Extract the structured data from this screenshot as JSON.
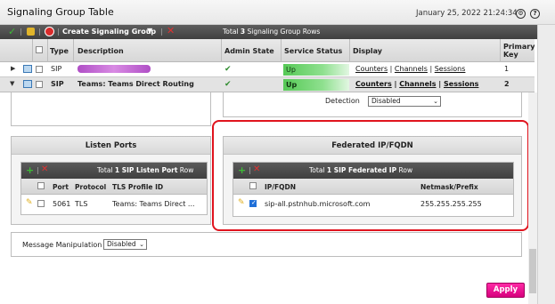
{
  "window": {
    "title": "Signaling Group Table",
    "date": "January 25, 2022 21:24:34",
    "icons": [
      "settings-icon",
      "help-icon"
    ]
  },
  "toolbar": {
    "create_label": "Create Signaling Group",
    "total_prefix": "Total ",
    "total_count": "3",
    "total_suffix": " Signaling Group Rows"
  },
  "table": {
    "columns": [
      "Type",
      "Description",
      "Admin State",
      "Service Status",
      "Display",
      "Primary Key"
    ],
    "rows": [
      {
        "type": "SIP",
        "description": "",
        "status": "Up",
        "links": [
          "Counters",
          "Channels",
          "Sessions"
        ],
        "key": "1"
      },
      {
        "type": "SIP",
        "description": "Teams: Teams Direct Routing",
        "status": "Up",
        "links": [
          "Counters",
          "Channels",
          "Sessions"
        ],
        "key": "2"
      }
    ]
  },
  "detection": {
    "label": "Detection",
    "value": "Disabled"
  },
  "listen_ports": {
    "title": "Listen Ports",
    "total_prefix": "Total ",
    "total_count": "1",
    "total_suffix": " SIP Listen Port",
    "total_unit": " Row",
    "columns": [
      "Port",
      "Protocol",
      "TLS Profile ID"
    ],
    "row": {
      "port": "5061",
      "protocol": "TLS",
      "tls": "Teams: Teams Direct ..."
    }
  },
  "federated": {
    "title": "Federated IP/FQDN",
    "total_prefix": "Total ",
    "total_count": "1",
    "total_suffix": " SIP Federated IP",
    "total_unit": " Row",
    "columns": [
      "IP/FQDN",
      "Netmask/Prefix"
    ],
    "row": {
      "fqdn": "sip-all.pstnhub.microsoft.com",
      "netmask": "255.255.255.255"
    }
  },
  "message_manipulation": {
    "label": "Message Manipulation",
    "value": "Disabled"
  },
  "apply_label": "Apply",
  "colors": {
    "accent": "#d6007d",
    "highlight": "#e0141e",
    "status_up": "#56c956"
  }
}
